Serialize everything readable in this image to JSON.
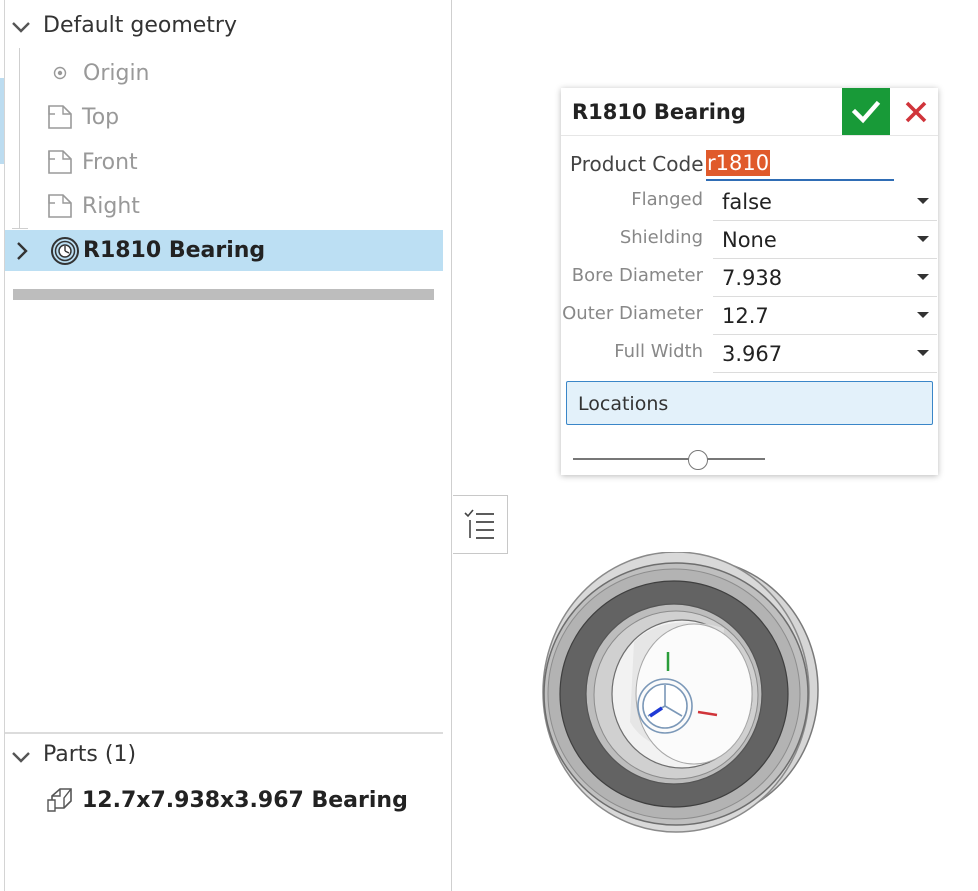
{
  "tree": {
    "default_geometry_label": "Default geometry",
    "items": [
      {
        "label": "Origin",
        "icon": "origin-point-icon"
      },
      {
        "label": "Top",
        "icon": "plane-icon"
      },
      {
        "label": "Front",
        "icon": "plane-icon"
      },
      {
        "label": "Right",
        "icon": "plane-icon"
      }
    ],
    "feature": {
      "label": "R1810 Bearing",
      "icon": "bearing-feature-icon"
    }
  },
  "parts": {
    "title": "Parts (1)",
    "items": [
      {
        "label": "12.7x7.938x3.967 Bearing",
        "icon": "part-icon"
      }
    ]
  },
  "dialog": {
    "title": "R1810 Bearing",
    "product_code_label": "Product Code",
    "product_code_value": "r1810",
    "params": [
      {
        "label": "Flanged",
        "value": "false"
      },
      {
        "label": "Shielding",
        "value": "None"
      },
      {
        "label": "Bore Diameter",
        "value": "7.938"
      },
      {
        "label": "Outer Diameter",
        "value": "12.7"
      },
      {
        "label": "Full Width",
        "value": "3.967"
      }
    ],
    "locations_label": "Locations",
    "slider_level": 0.65
  },
  "colors": {
    "selection": "#bcdff3",
    "ok_green": "#189a38",
    "cancel_red": "#d0343a",
    "highlight_orange": "#e05a2b",
    "focus_blue": "#2f6db5"
  }
}
